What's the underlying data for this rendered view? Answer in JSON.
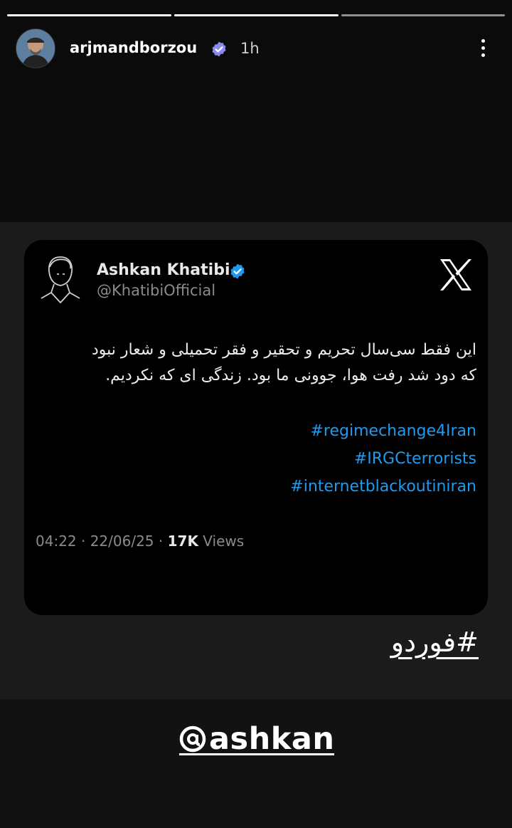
{
  "story": {
    "progress_bars": [
      {
        "state": "active"
      },
      {
        "state": "active"
      },
      {
        "state": "active"
      }
    ],
    "username": "arjmandborzou",
    "time_ago": "1h",
    "menu_icon": "more-vertical-icon"
  },
  "tweet": {
    "author_name": "Ashkan Khatibi",
    "handle": "@KhatibiOfficial",
    "text_line1": "این فقط سی‌سال تحریم و تحقیر و فقر تحمیلی و شعار نبود",
    "text_line2": "که دود شد رفت هوا، جوونی ما بود. زندگی ای که نکردیم.",
    "hashtags": [
      "#regimechange4Iran",
      "#IRGCterrorists",
      "#internetblackoutiniran"
    ],
    "time_date": "04:22 · 22/06/25 · ",
    "views_count": "17K",
    "views_label": " Views",
    "platform_icon": "x-logo-icon"
  },
  "overlays": {
    "hashtag_sticker": "#فوردو",
    "mention": "ashkan",
    "mention_icon": "threads-icon"
  },
  "colors": {
    "link": "#1d9bf0",
    "verified_ig": "#8a8af0",
    "verified_x": "#1d9bf0"
  }
}
